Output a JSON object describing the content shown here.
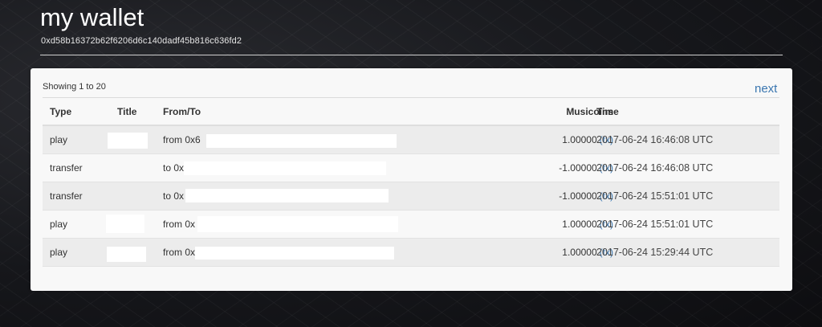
{
  "header": {
    "title": "my wallet",
    "address": "0xd58b16372b62f6206d6c140dadf45b816c636fd2"
  },
  "panel": {
    "showing": "Showing 1 to 20",
    "next_label": "next"
  },
  "table": {
    "columns": {
      "type": "Type",
      "title": "Title",
      "from_to": "From/To",
      "musicoins": "Musicoins",
      "time": "Time"
    },
    "rows": [
      {
        "type": "play",
        "title": "",
        "from_to": "from 0x6",
        "amount": "1.00000",
        "tx": "(tx)",
        "time": "2017-06-24 16:46:08 UTC"
      },
      {
        "type": "transfer",
        "title": "",
        "from_to": "to 0x",
        "amount": "-1.00000",
        "tx": "(tx)",
        "time": "2017-06-24 16:46:08 UTC"
      },
      {
        "type": "transfer",
        "title": "",
        "from_to": "to 0x",
        "amount": "-1.00000",
        "tx": "(tx)",
        "time": "2017-06-24 15:51:01 UTC"
      },
      {
        "type": "play",
        "title": "",
        "from_to": "from 0x",
        "amount": "1.00000",
        "tx": "(tx)",
        "time": "2017-06-24 15:51:01 UTC"
      },
      {
        "type": "play",
        "title": "",
        "from_to": "from 0x",
        "amount": "1.00000",
        "tx": "(tx)",
        "time": "2017-06-24 15:29:44 UTC"
      }
    ]
  },
  "colors": {
    "link": "#3a76b0",
    "panel": "#f8f8f8",
    "row_stripe": "#ececec"
  }
}
